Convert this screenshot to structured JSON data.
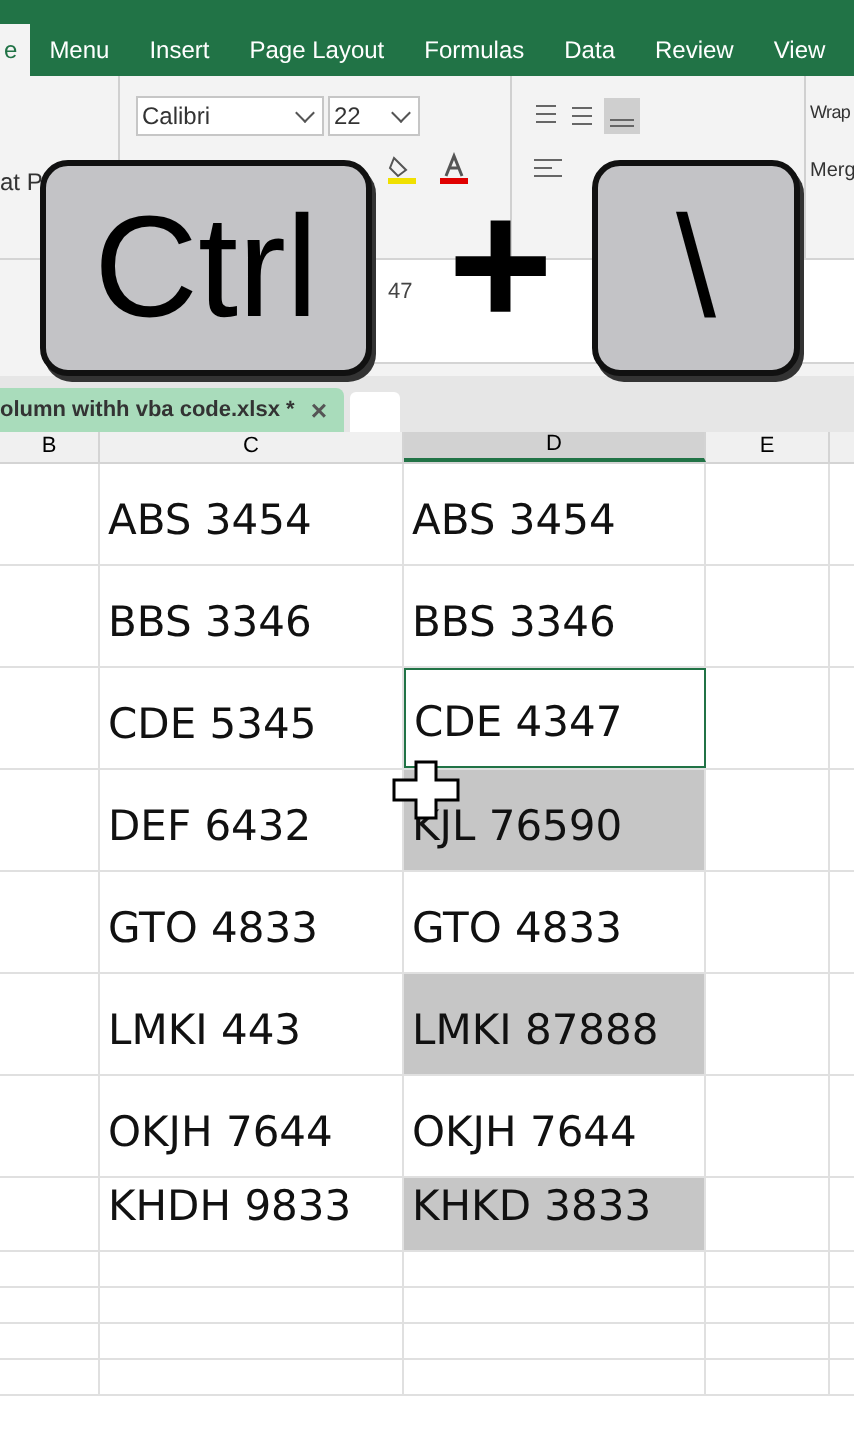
{
  "ribbon_tabs": [
    {
      "label": "e",
      "selected": true
    },
    {
      "label": "Menu",
      "selected": false
    },
    {
      "label": "Insert",
      "selected": false
    },
    {
      "label": "Page Layout",
      "selected": false
    },
    {
      "label": "Formulas",
      "selected": false
    },
    {
      "label": "Data",
      "selected": false
    },
    {
      "label": "Review",
      "selected": false
    },
    {
      "label": "View",
      "selected": false
    }
  ],
  "ribbon": {
    "clipboard_label": "at P",
    "font_name": "Calibri",
    "font_size": "22",
    "wrap_label": "Wrap",
    "merge_label": "Merg"
  },
  "formula_bar": {
    "value": "47"
  },
  "document_tab": {
    "label": "olumn withh vba code.xlsx *",
    "close": "×",
    "selected": true
  },
  "columns": [
    {
      "label": "B",
      "selected": false
    },
    {
      "label": "C",
      "selected": false
    },
    {
      "label": "D",
      "selected": true
    },
    {
      "label": "E",
      "selected": false
    }
  ],
  "rows": [
    {
      "c": "ABS 3454",
      "d": "ABS 3454",
      "highlighted": false,
      "active": false
    },
    {
      "c": "BBS 3346",
      "d": "BBS 3346",
      "highlighted": false,
      "active": false
    },
    {
      "c": "CDE 5345",
      "d": "CDE 4347",
      "highlighted": false,
      "active": true
    },
    {
      "c": "DEF 6432",
      "d": "KJL 76590",
      "highlighted": true,
      "active": false
    },
    {
      "c": "GTO 4833",
      "d": "GTO 4833",
      "highlighted": false,
      "active": false
    },
    {
      "c": "LMKI 443",
      "d": "LMKI 87888",
      "highlighted": true,
      "active": false
    },
    {
      "c": "OKJH 7644",
      "d": "OKJH 7644",
      "highlighted": false,
      "active": false
    },
    {
      "c": "KHDH 9833",
      "d": "KHKD 3833",
      "highlighted": true,
      "active": false
    }
  ],
  "shortcut_overlay": {
    "keys": [
      "Ctrl",
      "\\"
    ],
    "joiner": "+"
  }
}
